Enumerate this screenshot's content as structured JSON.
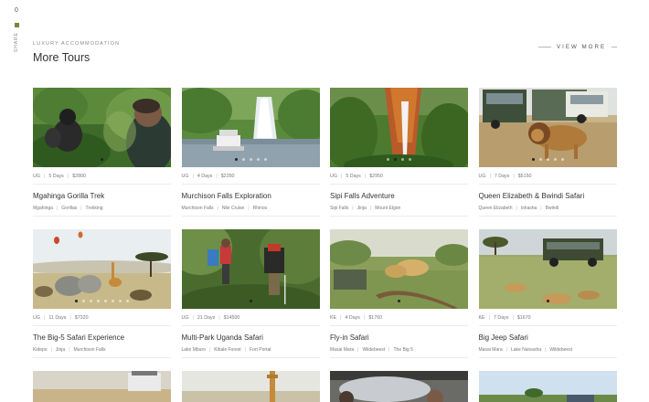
{
  "share": {
    "count": "0",
    "label": "SHARE"
  },
  "header": {
    "eyebrow": "LUXURY ACCOMMODATION",
    "title": "More Tours"
  },
  "view_more": {
    "label": "VIEW MORE"
  },
  "cards": [
    {
      "country": "UG",
      "days": "5 Days",
      "price": "$2800",
      "title": "Mgahinga Gorilla Trek",
      "tags": [
        "Mgahinga",
        "Gorillas",
        "Trekking"
      ],
      "dots": 1,
      "active": 0
    },
    {
      "country": "UG",
      "days": "4 Days",
      "price": "$2350",
      "title": "Murchison Falls Exploration",
      "tags": [
        "Murchison Falls",
        "Nile Cruise",
        "Rhinos"
      ],
      "dots": 5,
      "active": 0
    },
    {
      "country": "UG",
      "days": "5 Days",
      "price": "$2950",
      "title": "Sipi Falls Adventure",
      "tags": [
        "Sipi Falls",
        "Jinja",
        "Mount Elgon"
      ],
      "dots": 4,
      "active": 1
    },
    {
      "country": "UG",
      "days": "7 Days",
      "price": "$5150",
      "title": "Queen Elizabeth & Bwindi Safari",
      "tags": [
        "Queen Elizabeth",
        "Ishasha",
        "Bwindi"
      ],
      "dots": 5,
      "active": 0
    },
    {
      "country": "UG",
      "days": "11 Days",
      "price": "$7320",
      "title": "The Big-5 Safari Experience",
      "tags": [
        "Kidepo",
        "Jinja",
        "Murchison Falls"
      ],
      "dots": 8,
      "active": 0
    },
    {
      "country": "UG",
      "days": "21 Days",
      "price": "$14500",
      "title": "Multi-Park Uganda Safari",
      "tags": [
        "Lake Mburo",
        "Kibale Forest",
        "Fort Portal"
      ],
      "dots": 1,
      "active": 0
    },
    {
      "country": "KE",
      "days": "4 Days",
      "price": "$1760",
      "title": "Fly-in Safari",
      "tags": [
        "Masai Mara",
        "Wildebeest",
        "The Big 5"
      ],
      "dots": 1,
      "active": 0
    },
    {
      "country": "KE",
      "days": "7 Days",
      "price": "$1670",
      "title": "Big Jeep Safari",
      "tags": [
        "Masai Mara",
        "Lake Naivasha",
        "Wildebeest"
      ],
      "dots": 1,
      "active": 0
    }
  ]
}
